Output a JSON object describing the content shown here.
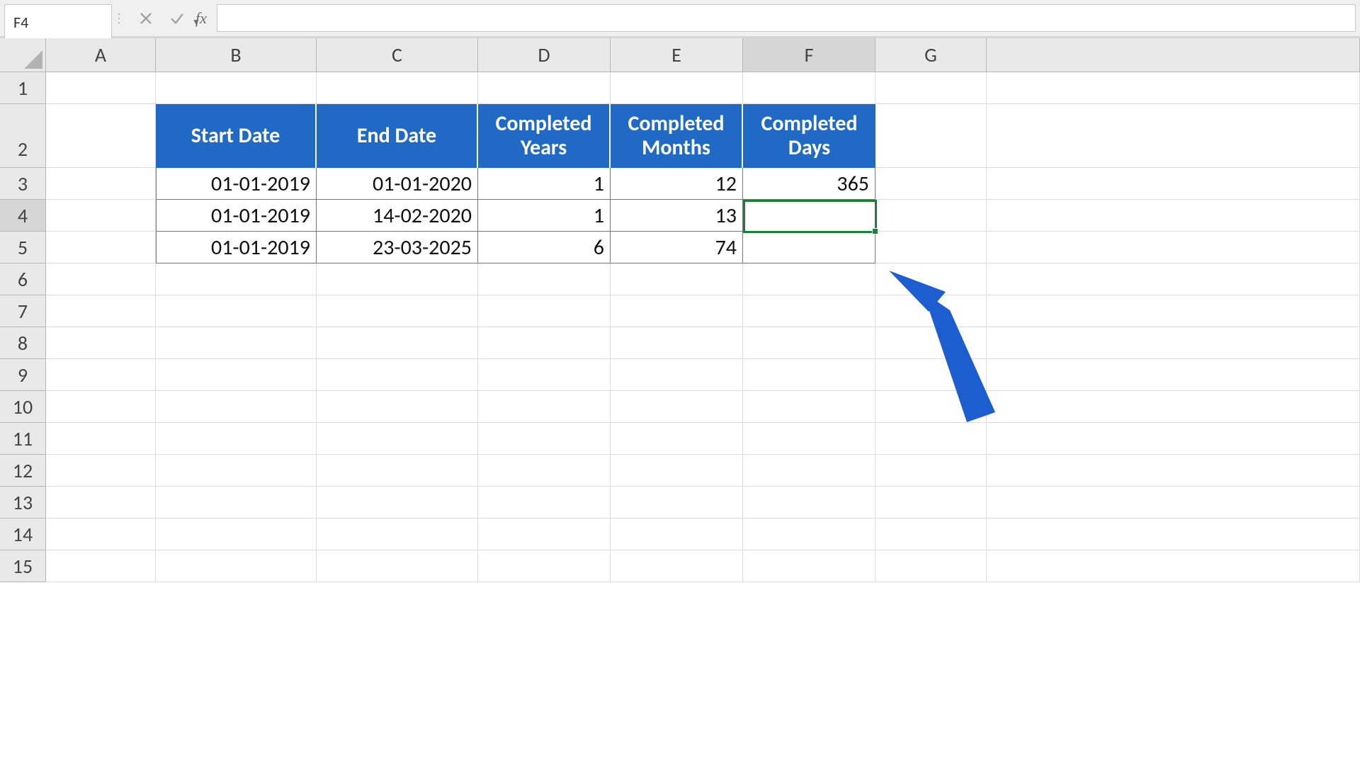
{
  "formula_bar": {
    "name_box": "F4",
    "formula": "",
    "fx_label": "fx",
    "cancel_tip": "Cancel",
    "enter_tip": "Enter"
  },
  "columns": [
    {
      "label": "A",
      "class": "w-A"
    },
    {
      "label": "B",
      "class": "w-B"
    },
    {
      "label": "C",
      "class": "w-C"
    },
    {
      "label": "D",
      "class": "w-D"
    },
    {
      "label": "E",
      "class": "w-E"
    },
    {
      "label": "F",
      "class": "w-F",
      "active": true
    },
    {
      "label": "G",
      "class": "w-G"
    }
  ],
  "row_labels": [
    "1",
    "2",
    "3",
    "4",
    "5",
    "6",
    "7",
    "8",
    "9",
    "10",
    "11",
    "12",
    "13",
    "14",
    "15"
  ],
  "active_row": "4",
  "table": {
    "headers": {
      "B": "Start Date",
      "C": "End Date",
      "D": "Completed Years",
      "E": "Completed Months",
      "F": "Completed Days"
    },
    "rows": [
      {
        "B": "01-01-2019",
        "C": "01-01-2020",
        "D": "1",
        "E": "12",
        "F": "365"
      },
      {
        "B": "01-01-2019",
        "C": "14-02-2020",
        "D": "1",
        "E": "13",
        "F": ""
      },
      {
        "B": "01-01-2019",
        "C": "23-03-2025",
        "D": "6",
        "E": "74",
        "F": ""
      }
    ]
  },
  "selection": {
    "cell": "F4"
  },
  "colors": {
    "accent": "#2069c4",
    "selection": "#1b7f3a",
    "arrow": "#1c5ecf"
  }
}
